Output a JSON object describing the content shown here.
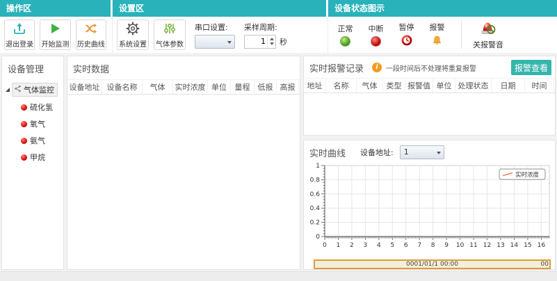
{
  "toolbar": {
    "sections": {
      "operation": {
        "title": "操作区",
        "buttons": [
          {
            "label": "退出登录",
            "icon": "logout-icon"
          },
          {
            "label": "开始监测",
            "icon": "play-icon"
          },
          {
            "label": "历史曲线",
            "icon": "history-curve-icon"
          }
        ]
      },
      "settings": {
        "title": "设置区",
        "buttons": [
          {
            "label": "系统设置",
            "icon": "gear-icon"
          },
          {
            "label": "气体参数",
            "icon": "sliders-icon"
          }
        ],
        "serial_port": {
          "label": "串口设置:",
          "value": ""
        },
        "sampling": {
          "label": "采样周期:",
          "value": "1",
          "unit": "秒"
        }
      },
      "status": {
        "title": "设备状态图示",
        "legend": [
          {
            "label": "正常",
            "color": "#4aa21c"
          },
          {
            "label": "中断",
            "color": "#c40a0a"
          },
          {
            "label": "暂停",
            "color": "#c40a0a"
          },
          {
            "label": "报警",
            "color": "#f0a030"
          }
        ],
        "mute_button": "关报警音"
      }
    }
  },
  "device_panel": {
    "title": "设备管理",
    "tree_root": "气体监控",
    "tree_items": [
      "硫化氢",
      "氧气",
      "氨气",
      "甲烷"
    ]
  },
  "realtime_data": {
    "title": "实时数据",
    "columns": [
      "设备地址",
      "设备名称",
      "气体",
      "实时浓度",
      "单位",
      "量程",
      "低报",
      "高报"
    ],
    "rows": []
  },
  "alarm_records": {
    "title": "实时报警记录",
    "notice": "一段时间后不处理将重复报警",
    "view_button": "报警查看",
    "columns": [
      "地址",
      "名称",
      "气体",
      "类型",
      "报警值",
      "单位",
      "处理状态",
      "日期",
      "时间"
    ],
    "rows": []
  },
  "curve_panel": {
    "title": "实时曲线",
    "device_address_label": "设备地址:",
    "device_address_value": "1",
    "range_label": "0001/01/1   00:00",
    "range_label_right": "00"
  },
  "chart_data": {
    "type": "line",
    "title": "实时曲线",
    "series": [
      {
        "name": "实时浓度",
        "color": "#f0855a",
        "x": [],
        "values": []
      }
    ],
    "xlim": [
      0,
      16.6
    ],
    "ylim": [
      0,
      1
    ],
    "x_ticks": [
      0,
      1,
      2,
      3,
      4,
      5,
      6,
      7,
      8,
      9,
      10,
      11,
      12,
      13,
      14,
      15,
      16
    ],
    "y_ticks": [
      0,
      0.2,
      0.4,
      0.6,
      0.8,
      1
    ],
    "x_minor_step": 0.1,
    "y_minor_step": 0.04,
    "grid": true,
    "legend_position": "top-right"
  },
  "colors": {
    "accent": "#29b2ba",
    "view_button": "#35b5ab",
    "curve_line": "#f0855a",
    "range_border": "#dd9b3f",
    "range_bg": "#f3efd7",
    "status_normal": "#4aa21c",
    "status_alarm_red": "#c40a0a",
    "bell_orange": "#f0a030"
  }
}
